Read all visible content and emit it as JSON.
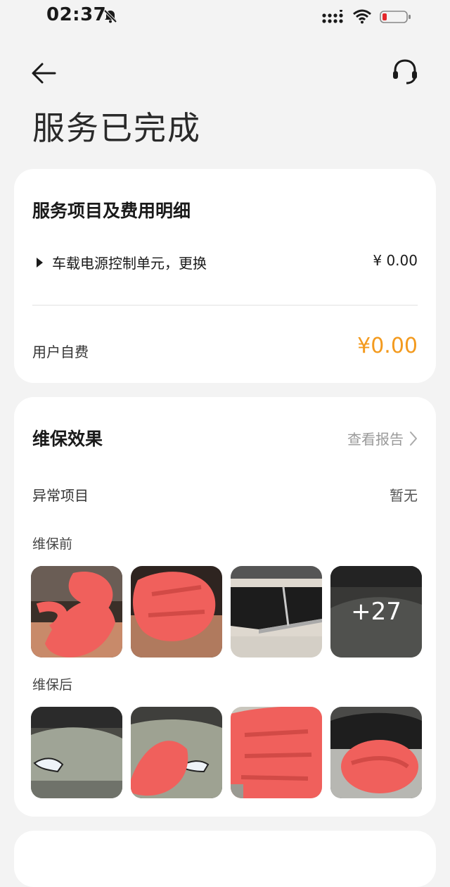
{
  "status_bar": {
    "time": "02:37"
  },
  "header": {
    "title": "服务已完成"
  },
  "fees": {
    "section_title": "服务项目及费用明细",
    "items": [
      {
        "name": "车载电源控制单元，更换",
        "price": "¥ 0.00"
      }
    ],
    "self_pay_label": "用户自费",
    "self_pay_amount": "¥0.00"
  },
  "maintenance": {
    "section_title": "维保效果",
    "report_link": "查看报告",
    "abnormal_label": "异常项目",
    "abnormal_value": "暂无",
    "before_label": "维保前",
    "after_label": "维保后",
    "more_count": "+27"
  },
  "colors": {
    "accent_orange": "#f39a1e",
    "scribble_red": "#f0605c"
  }
}
